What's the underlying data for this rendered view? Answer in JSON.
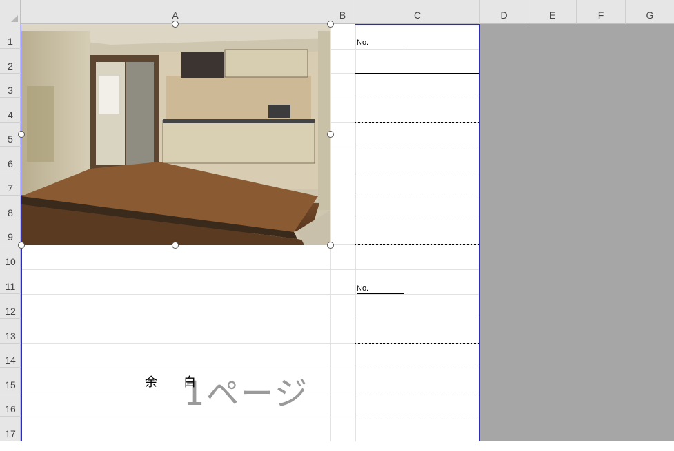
{
  "columns": [
    "A",
    "B",
    "C",
    "D",
    "E",
    "F",
    "G"
  ],
  "rows": [
    "1",
    "2",
    "3",
    "4",
    "5",
    "6",
    "7",
    "8",
    "9",
    "10",
    "11",
    "12",
    "13",
    "14",
    "15",
    "16",
    "17"
  ],
  "sheet": {
    "block1": {
      "no_label": "No."
    },
    "block2": {
      "no_label": "No."
    },
    "margin_note": "余白",
    "page_watermark": "1ページ"
  },
  "colors": {
    "page_break": "#2b2bbd",
    "outside_print_area": "#a6a6a6",
    "header_bg": "#e6e6e6"
  }
}
